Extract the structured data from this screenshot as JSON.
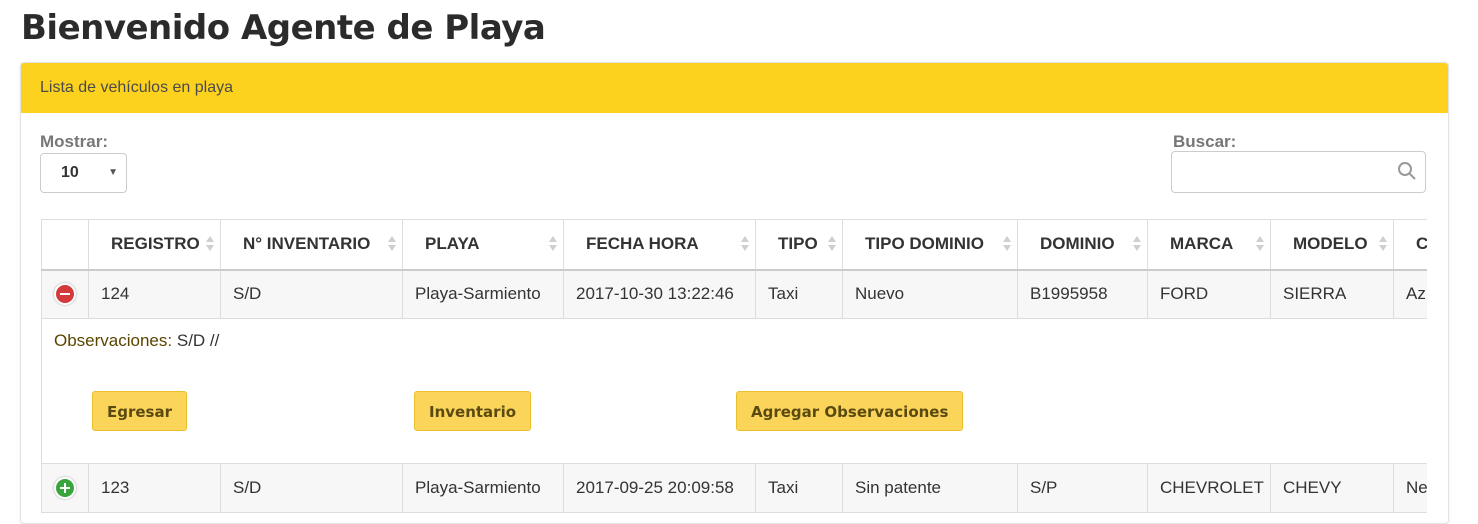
{
  "page": {
    "title": "Bienvenido Agente de Playa"
  },
  "panel": {
    "heading": "Lista de vehículos en playa"
  },
  "controls": {
    "length_label": "Mostrar:",
    "length_value": "10",
    "search_label": "Buscar:",
    "search_placeholder": ""
  },
  "table": {
    "headers": [
      "",
      "REGISTRO",
      "N° INVENTARIO",
      "PLAYA",
      "FECHA HORA",
      "TIPO",
      "TIPO DOMINIO",
      "DOMINIO",
      "MARCA",
      "MODELO",
      "C"
    ],
    "rows": [
      {
        "expanded": true,
        "cells": [
          "124",
          "S/D",
          "Playa-Sarmiento",
          "2017-10-30 13:22:46",
          "Taxi",
          "Nuevo",
          "B1995958",
          "FORD",
          "SIERRA",
          "Az"
        ]
      },
      {
        "expanded": false,
        "cells": [
          "123",
          "S/D",
          "Playa-Sarmiento",
          "2017-09-25 20:09:58",
          "Taxi",
          "Sin patente",
          "S/P",
          "CHEVROLET",
          "CHEVY",
          "Ne"
        ]
      }
    ],
    "child": {
      "obs_label": "Observaciones:",
      "obs_value": "S/D //",
      "btn_egresar": "Egresar",
      "btn_inventario": "Inventario",
      "btn_agregar": "Agregar Observaciones"
    }
  },
  "colors": {
    "accent": "#fdd21f",
    "button": "#fbd55a",
    "collapse": "#d33b3b",
    "expand": "#3aa53a"
  }
}
